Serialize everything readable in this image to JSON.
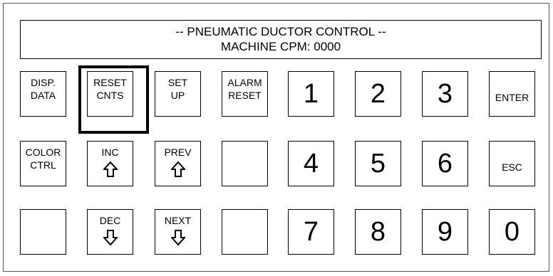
{
  "display": {
    "line1": "-- PNEUMATIC DUCTOR CONTROL --",
    "line2": "MACHINE CPM: 0000"
  },
  "keys": {
    "disp_data": [
      "DISP.",
      "DATA"
    ],
    "reset_cnts": [
      "RESET",
      "CNTS"
    ],
    "set_up": [
      "SET",
      "UP"
    ],
    "alarm_reset": [
      "ALARM",
      "RESET"
    ],
    "color_ctrl": [
      "COLOR",
      "CTRL"
    ],
    "inc": "INC",
    "prev": "PREV",
    "dec": "DEC",
    "next": "NEXT",
    "enter": "ENTER",
    "esc": "ESC",
    "digits": [
      "1",
      "2",
      "3",
      "4",
      "5",
      "6",
      "7",
      "8",
      "9",
      "0"
    ]
  },
  "icons": {
    "inc": "arrow-up-outline-icon",
    "prev": "arrow-up-outline-icon",
    "dec": "arrow-down-outline-icon",
    "next": "arrow-down-outline-icon"
  },
  "focused_key": "reset_cnts"
}
